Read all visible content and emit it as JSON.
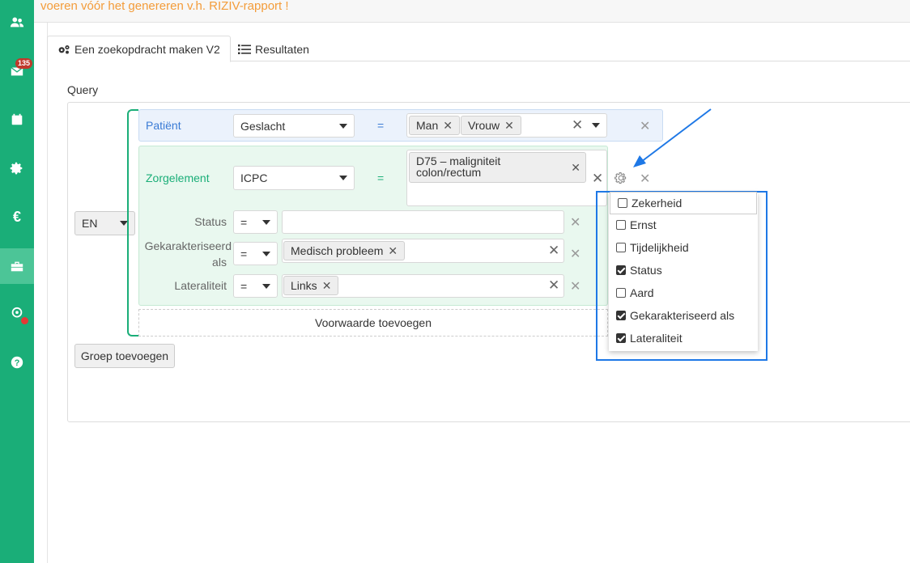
{
  "banner": {
    "text": "voeren vóór het genereren v.h. RIZIV-rapport !"
  },
  "sidebar": {
    "items": [
      {
        "icon": "users-icon"
      },
      {
        "icon": "mail-icon",
        "badge": "135"
      },
      {
        "icon": "calendar-icon"
      },
      {
        "icon": "gear-icon"
      },
      {
        "icon": "euro-icon"
      },
      {
        "icon": "toolbox-icon",
        "active": true
      },
      {
        "icon": "location-icon"
      },
      {
        "icon": "help-icon"
      }
    ]
  },
  "tabs": [
    {
      "label": "Een zoekopdracht maken V2",
      "icon": "cogs-icon",
      "active": true
    },
    {
      "label": "Resultaten",
      "icon": "list-icon",
      "active": false
    }
  ],
  "query": {
    "label": "Query",
    "operator": "EN",
    "patient_row": {
      "label": "Patiënt",
      "field": "Geslacht",
      "eq": "=",
      "tags": [
        "Man",
        "Vrouw"
      ]
    },
    "care_row": {
      "label": "Zorgelement",
      "field": "ICPC",
      "eq": "=",
      "tag_line1": "D75 – maligniteit",
      "tag_line2": "colon/rectum",
      "sub_rows": [
        {
          "label": "Status",
          "op": "=",
          "value": ""
        },
        {
          "label_line1": "Gekarakteriseerd",
          "label_line2": "als",
          "op": "=",
          "tag": "Medisch probleem"
        },
        {
          "label": "Lateraliteit",
          "op": "=",
          "tag": "Links"
        }
      ]
    },
    "add_condition": "Voorwaarde toevoegen",
    "add_group": "Groep toevoegen"
  },
  "popup": {
    "options": [
      {
        "label": "Zekerheid",
        "checked": false
      },
      {
        "label": "Ernst",
        "checked": false
      },
      {
        "label": "Tijdelijkheid",
        "checked": false
      },
      {
        "label": "Status",
        "checked": true
      },
      {
        "label": "Aard",
        "checked": false
      },
      {
        "label": "Gekarakteriseerd als",
        "checked": true
      },
      {
        "label": "Lateraliteit",
        "checked": true
      }
    ]
  },
  "colors": {
    "brand": "#1aae78",
    "highlight": "#1e78e6",
    "banner_text": "#f39c3a",
    "badge": "#c0392b"
  }
}
